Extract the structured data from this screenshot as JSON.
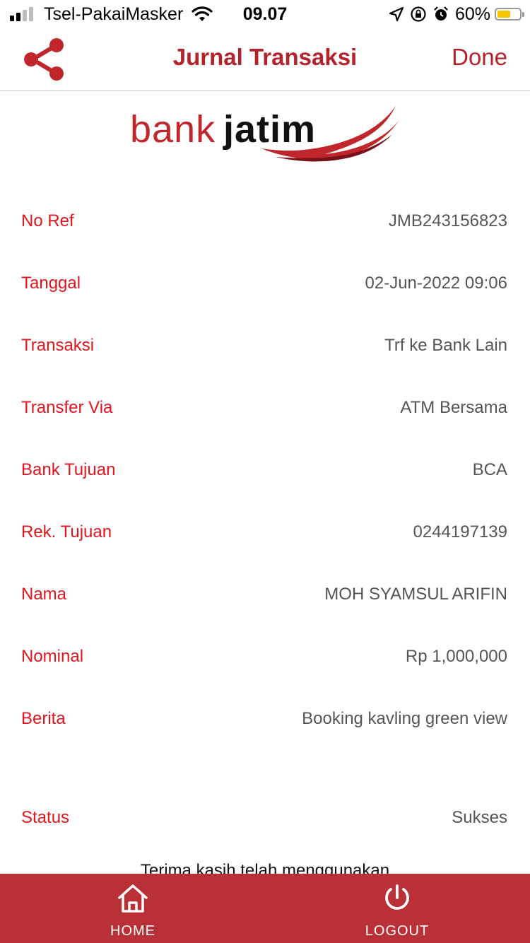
{
  "status_bar": {
    "carrier": "Tsel-PakaiMasker",
    "time": "09.07",
    "battery_percent": "60%",
    "battery_level": 0.6,
    "battery_color": "#f5c400"
  },
  "header": {
    "share_icon": "share-icon",
    "title": "Jurnal Transaksi",
    "done_label": "Done",
    "accent_color": "#b3232b"
  },
  "logo": {
    "bank": "bank",
    "jatim": "jatim"
  },
  "details": [
    {
      "label": "No Ref",
      "value": "JMB243156823"
    },
    {
      "label": "Tanggal",
      "value": "02-Jun-2022 09:06"
    },
    {
      "label": "Transaksi",
      "value": "Trf ke Bank Lain"
    },
    {
      "label": "Transfer Via",
      "value": "ATM Bersama"
    },
    {
      "label": "Bank Tujuan",
      "value": "BCA"
    },
    {
      "label": "Rek. Tujuan",
      "value": "0244197139"
    },
    {
      "label": "Nama",
      "value": "MOH SYAMSUL ARIFIN"
    },
    {
      "label": "Nominal",
      "value": "Rp 1,000,000"
    },
    {
      "label": "Berita",
      "value": "Booking kavling green view"
    },
    {
      "label": "Status",
      "value": "Sukses"
    }
  ],
  "footer_message": "Terima kasih telah menggunakan",
  "tabbar": {
    "background": "#b93036",
    "home_label": "HOME",
    "home_icon": "home-icon",
    "logout_label": "LOGOUT",
    "logout_icon": "power-icon"
  }
}
